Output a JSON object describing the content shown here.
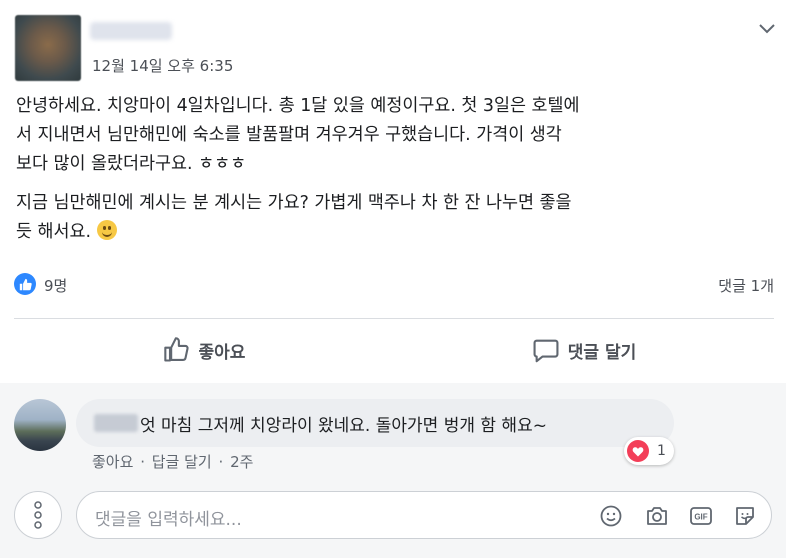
{
  "post": {
    "author_name": "",
    "timestamp": "12월 14일 오후 6:35",
    "paragraphs": [
      "안녕하세요. 치앙마이 4일차입니다. 총 1달 있을 예정이구요. 첫 3일은 호텔에\n서 지내면서 님만해민에 숙소를 발품팔며 겨우겨우 구했습니다. 가격이 생각\n보다 많이 올랐더라구요. ㅎㅎㅎ",
      "지금 님만해민에 계시는 분 계시는 가요? 가볍게 맥주나 차 한 잔 나누면 좋을\n듯 해서요."
    ],
    "emoji": "smiley-face-icon"
  },
  "reactions": {
    "like_count": "9명",
    "comment_count": "댓글 1개",
    "like_color": "#2d88ff"
  },
  "actions": {
    "like_label": "좋아요",
    "comment_label": "댓글 달기"
  },
  "comment": {
    "author_name": "",
    "text": "엇 마침 그저께 치앙라이 왔네요. 돌아가면 벙개 함 해요~",
    "reaction_count": "1",
    "reaction_color": "#f33e58",
    "like_link": "좋아요",
    "reply_link": "답글 달기",
    "time": "2주"
  },
  "composer": {
    "placeholder": "댓글을 입력하세요...",
    "icons": [
      "smiley-icon",
      "camera-icon",
      "gif-icon",
      "sticker-icon"
    ]
  }
}
